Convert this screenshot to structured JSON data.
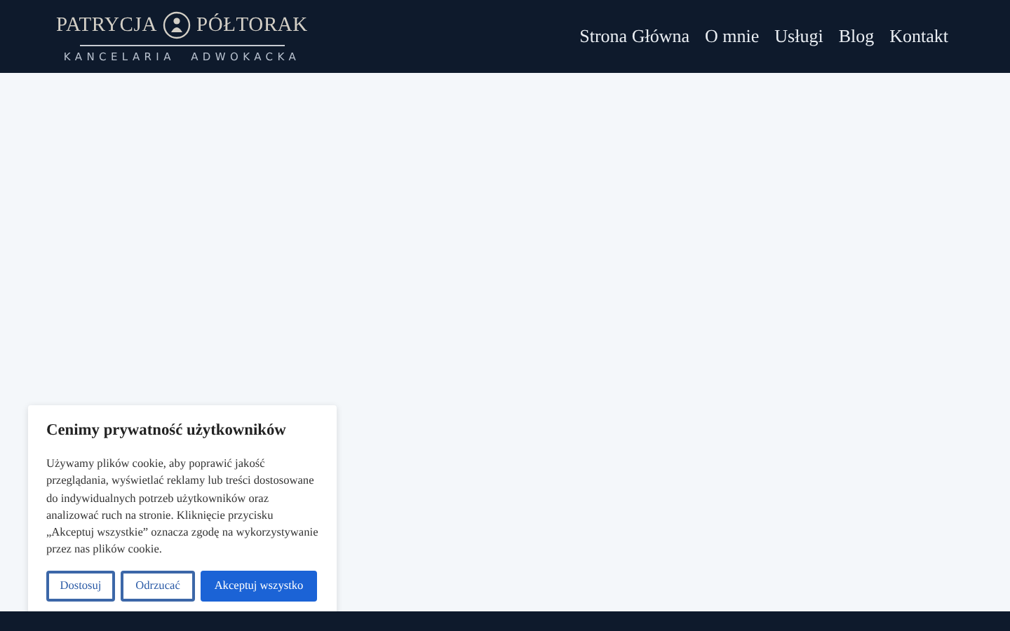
{
  "logo": {
    "first_name": "PATRYCJA",
    "last_name": "PÓŁTORAK",
    "tagline": "KANCELARIA  ADWOKACKA"
  },
  "nav": [
    {
      "label": "Strona Główna"
    },
    {
      "label": "O mnie"
    },
    {
      "label": "Usługi"
    },
    {
      "label": "Blog"
    },
    {
      "label": "Kontakt"
    }
  ],
  "cookie_banner": {
    "title": "Cenimy prywatność użytkowników",
    "text": "Używamy plików cookie, aby poprawić jakość przeglądania, wyświetlać reklamy lub treści dostosowane do indywidualnych potrzeb użytkowników oraz analizować ruch na stronie. Kliknięcie przycisku „Akceptuj wszystkie” oznacza zgodę na wykorzystywanie przez nas plików cookie.",
    "buttons": [
      {
        "label": "Dostosuj",
        "kind": "outline"
      },
      {
        "label": "Odrzucać",
        "kind": "outline"
      },
      {
        "label": "Akceptuj wszystko",
        "kind": "primary"
      }
    ]
  }
}
